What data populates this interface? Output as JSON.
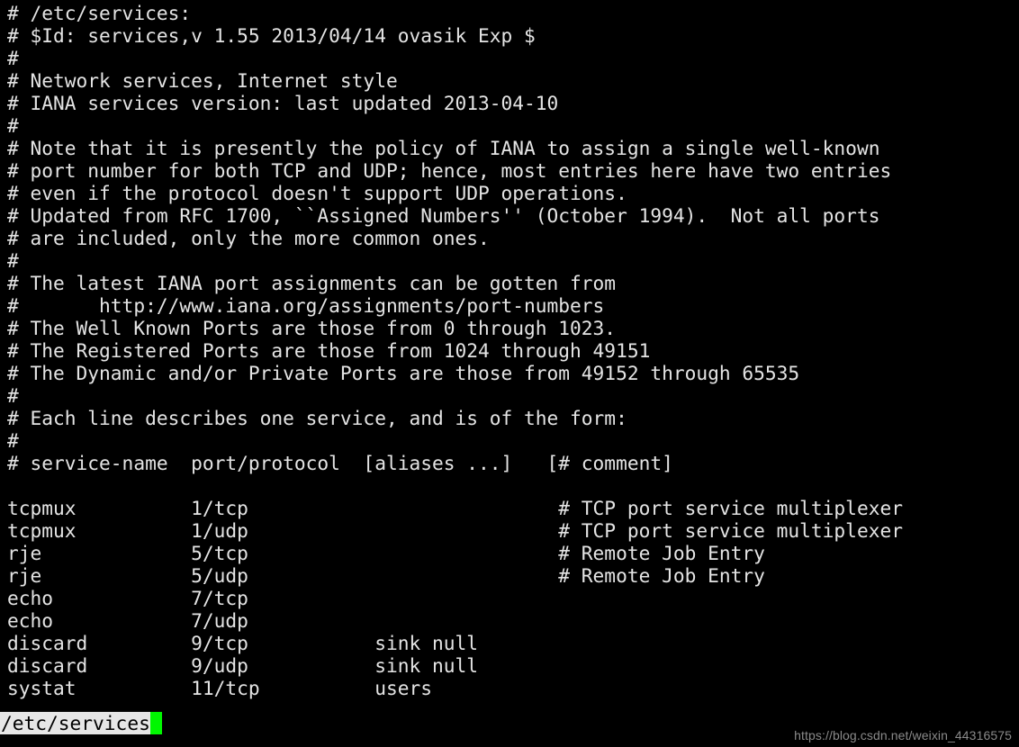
{
  "terminal": {
    "background_color": "#000000",
    "foreground_color": "#e4e4e4",
    "cursor_color": "#00f700",
    "status_bg_color": "#e6e6e6",
    "status_fg_color": "#000000"
  },
  "file": {
    "lines": [
      "# /etc/services:",
      "# $Id: services,v 1.55 2013/04/14 ovasik Exp $",
      "#",
      "# Network services, Internet style",
      "# IANA services version: last updated 2013-04-10",
      "#",
      "# Note that it is presently the policy of IANA to assign a single well-known",
      "# port number for both TCP and UDP; hence, most entries here have two entries",
      "# even if the protocol doesn't support UDP operations.",
      "# Updated from RFC 1700, ``Assigned Numbers'' (October 1994).  Not all ports",
      "# are included, only the more common ones.",
      "#",
      "# The latest IANA port assignments can be gotten from",
      "#       http://www.iana.org/assignments/port-numbers",
      "# The Well Known Ports are those from 0 through 1023.",
      "# The Registered Ports are those from 1024 through 49151",
      "# The Dynamic and/or Private Ports are those from 49152 through 65535",
      "#",
      "# Each line describes one service, and is of the form:",
      "#",
      "# service-name  port/protocol  [aliases ...]   [# comment]",
      "",
      "tcpmux          1/tcp                           # TCP port service multiplexer",
      "tcpmux          1/udp                           # TCP port service multiplexer",
      "rje             5/tcp                           # Remote Job Entry",
      "rje             5/udp                           # Remote Job Entry",
      "echo            7/tcp",
      "echo            7/udp",
      "discard         9/tcp           sink null",
      "discard         9/udp           sink null",
      "systat          11/tcp          users"
    ]
  },
  "status": {
    "filename": "/etc/services",
    "cursor": " "
  },
  "watermark": {
    "text": "https://blog.csdn.net/weixin_44316575"
  }
}
